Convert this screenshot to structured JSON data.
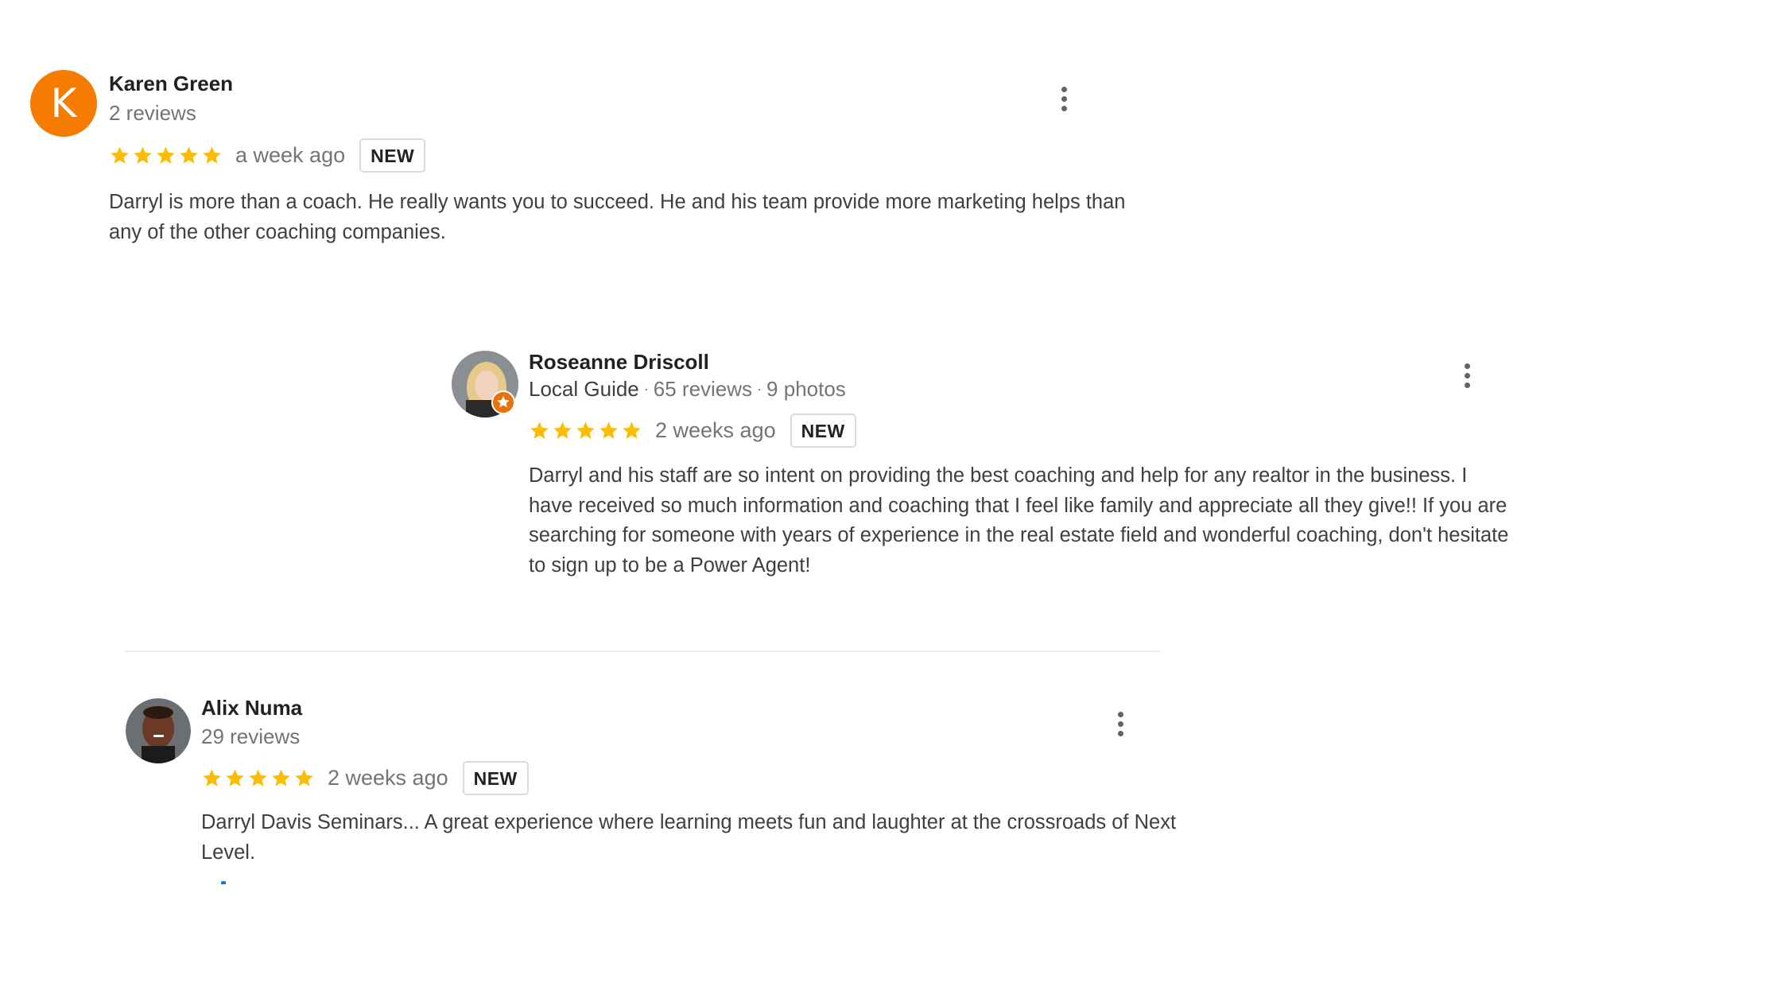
{
  "colors": {
    "star": "#fbbc04",
    "avatar_k": "#f57c00",
    "meta_text": "#70757a",
    "local_guide_badge": "#e8710a"
  },
  "reviews": [
    {
      "avatar_letter": "K",
      "name": "Karen Green",
      "meta": "2 reviews",
      "stars": 5,
      "time_ago": "a week ago",
      "badge": "NEW",
      "text": "Darryl is more than a coach. He really wants you to succeed. He and his team provide more marketing helps than any of the other coaching companies."
    },
    {
      "name": "Roseanne Driscoll",
      "local_guide": "Local Guide",
      "review_count": "65 reviews",
      "photo_count": "9 photos",
      "stars": 5,
      "time_ago": "2 weeks ago",
      "badge": "NEW",
      "text": "Darryl and his staff are so intent on providing the best coaching and help for any realtor in the business. I have received so much information and coaching that I feel like family and appreciate all they give!!  If you are searching for someone with years of experience in the real estate field and wonderful coaching, don't hesitate to sign up to be a Power Agent!"
    },
    {
      "name": "Alix Numa",
      "meta": "29 reviews",
      "stars": 5,
      "time_ago": "2 weeks ago",
      "badge": "NEW",
      "text": "Darryl Davis Seminars... A great experience where learning meets fun and laughter at the crossroads of Next Level."
    }
  ],
  "icons": {
    "more": "more-vert-icon",
    "star": "star-icon",
    "local_guide": "local-guide-star-icon"
  }
}
